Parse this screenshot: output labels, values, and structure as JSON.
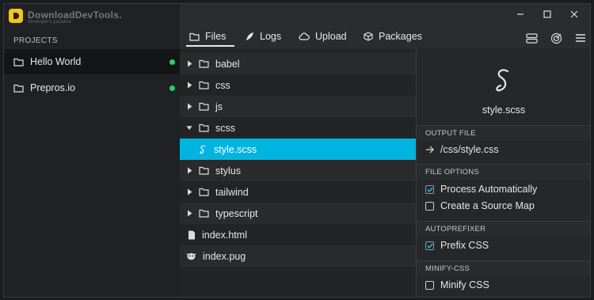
{
  "watermark": {
    "title": "DownloadDevTools.",
    "subtitle": "developer's paradise"
  },
  "sidebar": {
    "heading": "PROJECTS",
    "projects": [
      {
        "name": "Hello World",
        "status_color": "#2ecc71",
        "active": true
      },
      {
        "name": "Prepros.io",
        "status_color": "#2ecc71",
        "active": false
      }
    ]
  },
  "tabs": [
    {
      "label": "Files",
      "icon": "folder-icon",
      "active": true
    },
    {
      "label": "Logs",
      "icon": "feather-icon",
      "active": false
    },
    {
      "label": "Upload",
      "icon": "cloud-icon",
      "active": false
    },
    {
      "label": "Packages",
      "icon": "box-icon",
      "active": false
    }
  ],
  "toolbar_icons": [
    "server-icon",
    "radar-icon",
    "menu-icon"
  ],
  "window_controls": [
    "minimize-icon",
    "maximize-icon",
    "close-icon"
  ],
  "files": [
    {
      "name": "babel",
      "type": "folder",
      "expanded": false
    },
    {
      "name": "css",
      "type": "folder",
      "expanded": false
    },
    {
      "name": "js",
      "type": "folder",
      "expanded": false
    },
    {
      "name": "scss",
      "type": "folder",
      "expanded": true
    },
    {
      "name": "style.scss",
      "type": "scss-file",
      "selected": true
    },
    {
      "name": "stylus",
      "type": "folder",
      "expanded": false
    },
    {
      "name": "tailwind",
      "type": "folder",
      "expanded": false
    },
    {
      "name": "typescript",
      "type": "folder",
      "expanded": false
    },
    {
      "name": "index.html",
      "type": "html-file"
    },
    {
      "name": "index.pug",
      "type": "pug-file"
    }
  ],
  "details": {
    "file_name": "style.scss",
    "output_heading": "OUTPUT FILE",
    "output_path": "/css/style.css",
    "file_options_heading": "FILE OPTIONS",
    "process_automatically": "Process Automatically",
    "source_map": "Create a Source Map",
    "autoprefixer_heading": "AUTOPREFIXER",
    "prefix_css": "Prefix CSS",
    "minify_heading": "MINIFY-CSS",
    "minify_css": "Minify CSS"
  },
  "checkboxes": {
    "process_automatically": true,
    "source_map": false,
    "prefix_css": true,
    "minify_css": false
  },
  "colors": {
    "accent": "#00b4e0",
    "status_online": "#2ecc71",
    "checkbox": "#3db3e6"
  }
}
